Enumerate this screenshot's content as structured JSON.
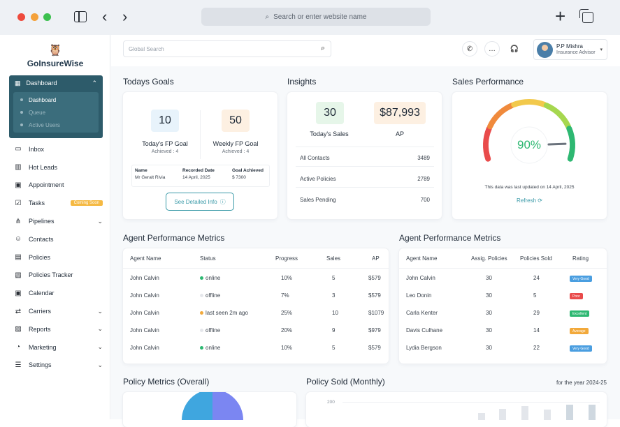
{
  "browser": {
    "url_placeholder": "Search or enter website name"
  },
  "app": {
    "name": "GoInsureWise"
  },
  "sidebar": {
    "dashboard": {
      "label": "Dashboard",
      "sub": [
        "Dashboard",
        "Queue",
        "Active Users"
      ]
    },
    "items": [
      {
        "label": "Inbox",
        "icon": "inbox-icon"
      },
      {
        "label": "Hot Leads",
        "icon": "chart-icon"
      },
      {
        "label": "Appointment",
        "icon": "calendar-icon"
      },
      {
        "label": "Tasks",
        "icon": "tasks-icon",
        "badge": "Coming Soon"
      },
      {
        "label": "Pipelines",
        "icon": "pipeline-icon",
        "chevron": true
      },
      {
        "label": "Contacts",
        "icon": "contacts-icon"
      },
      {
        "label": "Policies",
        "icon": "policy-icon"
      },
      {
        "label": "Policies Tracker",
        "icon": "tracker-icon"
      },
      {
        "label": "Calendar",
        "icon": "calendar-icon"
      },
      {
        "label": "Carriers",
        "icon": "carrier-icon",
        "chevron": true
      },
      {
        "label": "Reports",
        "icon": "reports-icon",
        "chevron": true
      },
      {
        "label": "Marketing",
        "icon": "marketing-icon",
        "chevron": true
      },
      {
        "label": "Settings",
        "icon": "settings-icon",
        "chevron": true
      }
    ]
  },
  "header": {
    "search_placeholder": "Global Search",
    "user": {
      "name": "P.P Mishra",
      "role": "Insurance Advisor"
    }
  },
  "todays_goals": {
    "title": "Todays Goals",
    "fp_goal": {
      "value": "10",
      "label": "Today's FP Goal",
      "achieved": "Achieved : 4"
    },
    "weekly_goal": {
      "value": "50",
      "label": "Weekly FP Goal",
      "achieved": "Achieved : 4"
    },
    "table": {
      "headers": [
        "Name",
        "Recorded Date",
        "Goal Achieved"
      ],
      "row": [
        "Mr Geralt Rivia",
        "14 April, 2025",
        "$ 7300"
      ]
    },
    "button": "See Detailed Info"
  },
  "insights": {
    "title": "Insights",
    "sales": {
      "value": "30",
      "label": "Today's Sales"
    },
    "ap": {
      "value": "$87,993",
      "label": "AP"
    },
    "rows": [
      {
        "label": "All Contacts",
        "value": "3489"
      },
      {
        "label": "Active Policies",
        "value": "2789"
      },
      {
        "label": "Sales Pending",
        "value": "700"
      }
    ]
  },
  "sales_performance": {
    "title": "Sales Performance",
    "percent": "90%",
    "percent_value": 90,
    "updated": "This data was last updated on 14 April, 2025",
    "refresh": "Refresh",
    "colors": [
      "#e94b4b",
      "#f08a3c",
      "#f2c94c",
      "#a6d74f",
      "#2eb872"
    ]
  },
  "agent_metrics_left": {
    "title": "Agent Performance Metrics",
    "headers": [
      "Agent Name",
      "Status",
      "Progress",
      "Sales",
      "AP"
    ],
    "rows": [
      {
        "name": "John Calvin",
        "status": "online",
        "status_color": "#2eb872",
        "progress": "10%",
        "sales": "5",
        "ap": "$579"
      },
      {
        "name": "John Calvin",
        "status": "offline",
        "status_color": "#e5e7eb",
        "progress": "7%",
        "sales": "3",
        "ap": "$579"
      },
      {
        "name": "John Calvin",
        "status": "last seen 2m ago",
        "status_color": "#f2a93b",
        "progress": "25%",
        "sales": "10",
        "ap": "$1079"
      },
      {
        "name": "John Calvin",
        "status": "offline",
        "status_color": "#e5e7eb",
        "progress": "20%",
        "sales": "9",
        "ap": "$979"
      },
      {
        "name": "John Calvin",
        "status": "online",
        "status_color": "#2eb872",
        "progress": "10%",
        "sales": "5",
        "ap": "$579"
      }
    ]
  },
  "agent_metrics_right": {
    "title": "Agent Performance Metrics",
    "headers": [
      "Agent Name",
      "Assig. Policies",
      "Policies Sold",
      "Rating"
    ],
    "rows": [
      {
        "name": "John Calvin",
        "assigned": "30",
        "sold": "24",
        "rating": "Very Good",
        "rating_color": "#4a9ee0"
      },
      {
        "name": "Leo Donin",
        "assigned": "30",
        "sold": "5",
        "rating": "Poor",
        "rating_color": "#e94b4b"
      },
      {
        "name": "Carla Kenter",
        "assigned": "30",
        "sold": "29",
        "rating": "Excellent",
        "rating_color": "#2eb872"
      },
      {
        "name": "Davis Culhane",
        "assigned": "30",
        "sold": "14",
        "rating": "Average",
        "rating_color": "#f2a93b"
      },
      {
        "name": "Lydia Bergson",
        "assigned": "30",
        "sold": "22",
        "rating": "Very Good",
        "rating_color": "#4a9ee0"
      }
    ]
  },
  "policy_metrics": {
    "title": "Policy Metrics (Overall)"
  },
  "policy_sold": {
    "title": "Policy Sold (Monthly)",
    "period": "for the year 2024-25",
    "y_tick": "200"
  }
}
